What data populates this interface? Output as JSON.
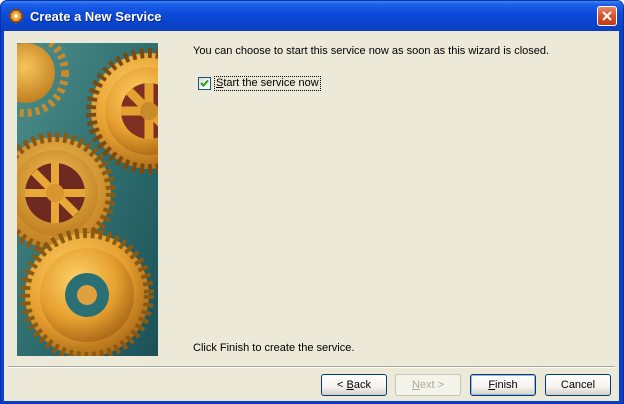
{
  "window": {
    "title": "Create a New Service",
    "icon": "gear-service-icon",
    "close_icon": "close-icon"
  },
  "content": {
    "intro": "You can choose to start this service now as soon as this wizard is closed.",
    "start_checkbox": {
      "label_pre": "S",
      "label_post": "tart the service now",
      "checked": true
    },
    "finish_instructions": "Click Finish to create the service."
  },
  "buttons": {
    "back": {
      "pre": "< ",
      "mnemonic": "B",
      "post": "ack"
    },
    "next": {
      "pre": "",
      "mnemonic": "N",
      "post": "ext >",
      "disabled": true
    },
    "finish": {
      "pre": "",
      "mnemonic": "F",
      "post": "inish"
    },
    "cancel": {
      "label": "Cancel"
    }
  },
  "colors": {
    "titlebar": "#0a43cc",
    "dialog_bg": "#ece9d8",
    "gear_gold": "#e9a23b",
    "image_teal": "#2a6f73"
  }
}
